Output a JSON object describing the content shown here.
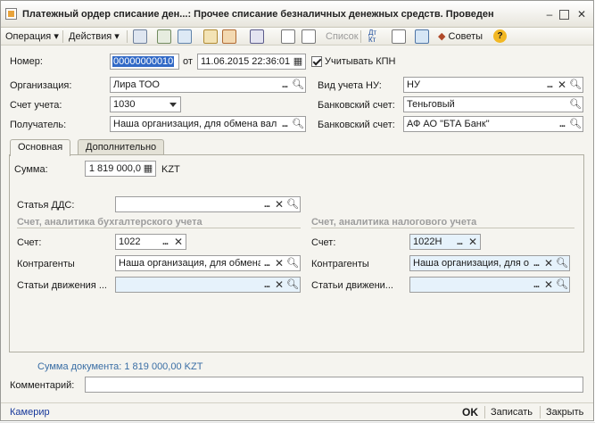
{
  "window": {
    "title": "Платежный ордер списание ден...: Прочее списание безналичных денежных средств. Проведен"
  },
  "toolbar": {
    "operation": "Операция",
    "actions": "Действия",
    "list": "Список",
    "tips": "Советы"
  },
  "form": {
    "number_label": "Номер:",
    "number": "00000000010",
    "date_label": "от",
    "date": "11.06.2015 22:36:01",
    "kpn_label": "Учитывать КПН",
    "org_label": "Организация:",
    "org": "Лира ТОО",
    "tax_type_label": "Вид учета НУ:",
    "tax_type": "НУ",
    "account_label": "Счет учета:",
    "account": "1030",
    "bank_account_label": "Банковский счет:",
    "bank_account": "Теньговый",
    "recipient_label": "Получатель:",
    "recipient": "Наша организация, для обмена вал",
    "bank_account2_label": "Банковский счет:",
    "bank_account2": "АФ АО \"БТА Банк\""
  },
  "tabs": [
    "Основная",
    "Дополнительно"
  ],
  "main": {
    "sum_label": "Сумма:",
    "sum": "1 819 000,0",
    "currency": "KZT",
    "dds_label": "Статья ДДС:",
    "dds": "",
    "buh_section": "Счет, аналитика бухгалтерского учета",
    "tax_section": "Счет, аналитика налогового учета",
    "buh_account_label": "Счет:",
    "buh_account": "1022",
    "tax_account_label": "Счет:",
    "tax_account": "1022Н",
    "buh_contragents_label": "Контрагенты",
    "buh_contragents": "Наша организация, для обмена",
    "tax_contragents_label": "Контрагенты",
    "tax_contragents": "Наша организация, для о",
    "buh_movement_label": "Статьи движения ...",
    "buh_movement": "",
    "tax_movement_label": "Статьи движени...",
    "tax_movement": ""
  },
  "doc_sum": "Сумма документа: 1 819 000,00 KZT",
  "comment_label": "Комментарий:",
  "comment": "",
  "status": {
    "cashier": "Камерир",
    "ok": "OK",
    "save": "Записать",
    "close": "Закрыть"
  },
  "colors": {
    "accent_link": "#17389b",
    "window_bg": "#f5f4ef",
    "selected_text_bg": "#3169c6",
    "tax_field_bg": "#e6f2fb"
  }
}
